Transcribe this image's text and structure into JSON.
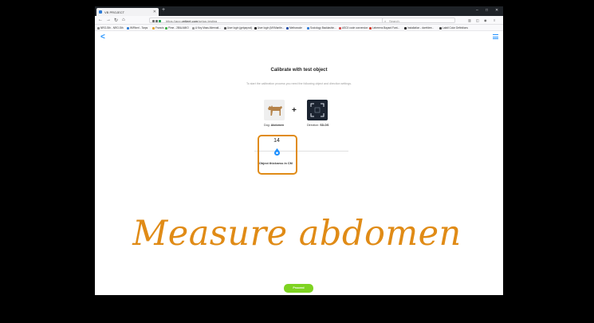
{
  "browser": {
    "tab_title": "VB PROJECT",
    "url_prefix": "https://app.",
    "url_domain": "vetjeet.com",
    "url_suffix": "/setup-testing",
    "page_actions": "··· ☆ ★",
    "search_placeholder": "Search",
    "window_controls": [
      "–",
      "□",
      "✕"
    ]
  },
  "bookmarks": [
    {
      "label": "NRO-Sth - NRO-Sth",
      "color": "#888888"
    },
    {
      "label": "WiFiberl - Tarps",
      "color": "#2b7bd6"
    },
    {
      "label": "Francis",
      "color": "#e0a12a"
    },
    {
      "label": "Pime - 2BIA AMIO",
      "color": "#3cb043"
    },
    {
      "label": "A Key Mass Alternati...",
      "color": "#999999"
    },
    {
      "label": "User login (getpaynol)",
      "color": "#555555"
    },
    {
      "label": "User login (MVMantle...",
      "color": "#1f1f1f"
    },
    {
      "label": "Methanode",
      "color": "#1b4aa6"
    },
    {
      "label": "Sociology Backlashin...",
      "color": "#2f7bd6"
    },
    {
      "label": "ASCII code conversion",
      "color": "#d84a4a"
    },
    {
      "label": "Leberens Bayard Fant...",
      "color": "#d23d2d"
    },
    {
      "label": "Installation - dcrefdee...",
      "color": "#222222"
    },
    {
      "label": "Lafall Color Definitions",
      "color": "#444444"
    }
  ],
  "app": {
    "title": "Calibrate with test object",
    "intro": "To start the calibration process you need the following object and direction settings.",
    "object_caption_label": "Dog:",
    "object_caption_value": "Abdomen",
    "direction_caption_label": "Direction:",
    "direction_caption_value": "SD-DS",
    "plus_sign": "+",
    "slider_value": "14",
    "slider_caption": "Object thickness in CM",
    "proceed_label": "Proceed"
  },
  "overlay_text": "Measure abdomen",
  "colors": {
    "accent": "#1e90ff",
    "highlight": "#e08b16",
    "proceed": "#7ed321"
  }
}
